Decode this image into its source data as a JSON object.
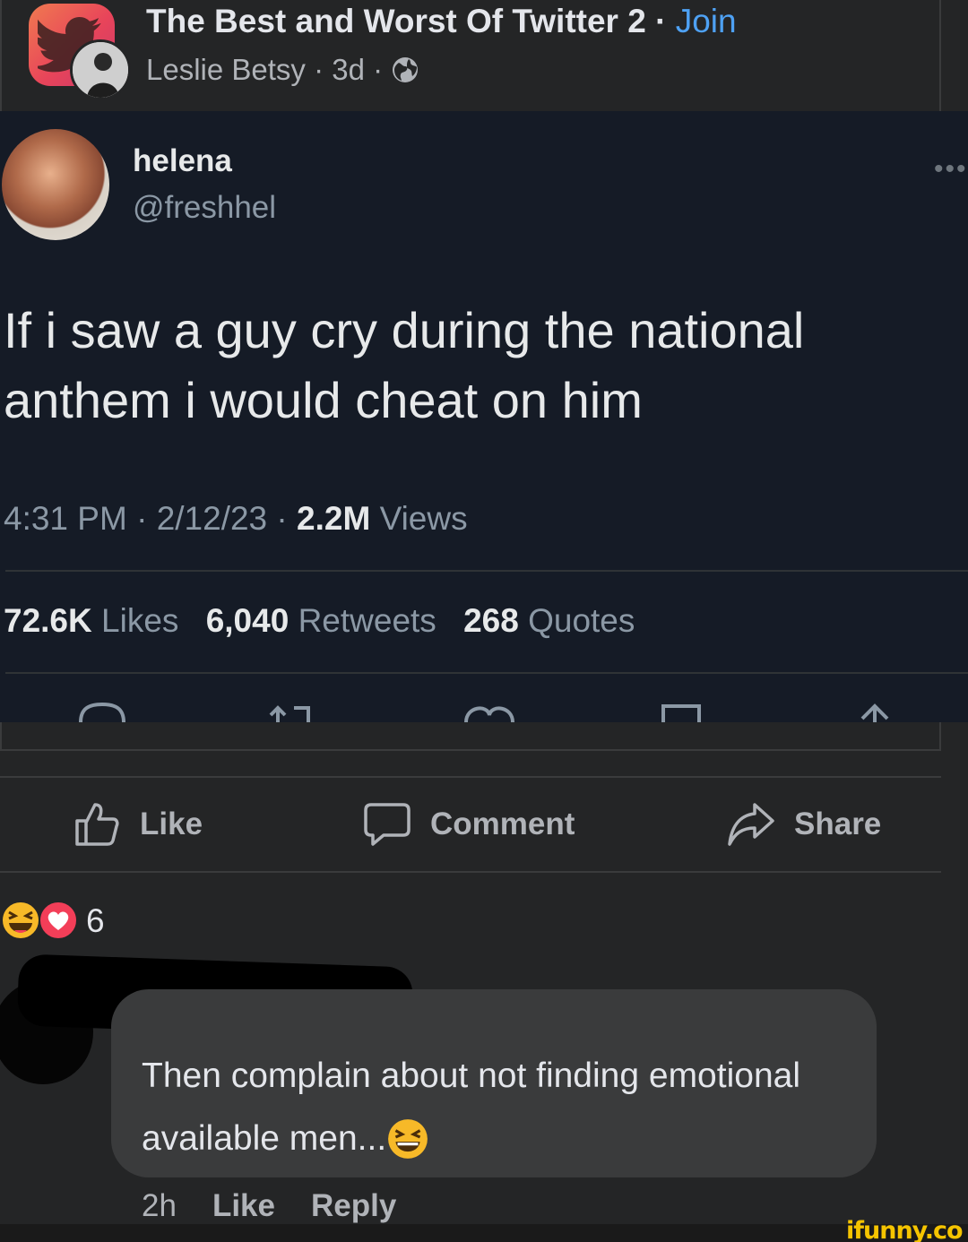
{
  "post": {
    "group_name": "The Best and Worst Of Twitter 2",
    "separator": " · ",
    "join_label": "Join",
    "author": "Leslie Betsy",
    "age": "3d",
    "meta_sep": " · "
  },
  "tweet": {
    "display_name": "helena",
    "handle": "@freshhel",
    "more": "•••",
    "text": "If i saw a guy cry during the national anthem i would cheat on him",
    "time": "4:31 PM",
    "date": "2/12/23",
    "views_count": "2.2M",
    "views_label": "Views",
    "likes_count": "72.6K",
    "likes_label": "Likes",
    "retweets_count": "6,040",
    "retweets_label": "Retweets",
    "quotes_count": "268",
    "quotes_label": "Quotes"
  },
  "actions": {
    "like_label": "Like",
    "comment_label": "Comment",
    "share_label": "Share"
  },
  "reactions": {
    "count": "6"
  },
  "comment": {
    "text": "Then complain about not finding emotional available men...",
    "age": "2h",
    "like_label": "Like",
    "reply_label": "Reply"
  },
  "watermark": "ifunny.co",
  "colors": {
    "background": "#242526",
    "tweet_bg": "#151b26",
    "link": "#4ea1f3",
    "bubble": "#3a3b3c",
    "love": "#f33e58",
    "haha": "#f7b928"
  }
}
